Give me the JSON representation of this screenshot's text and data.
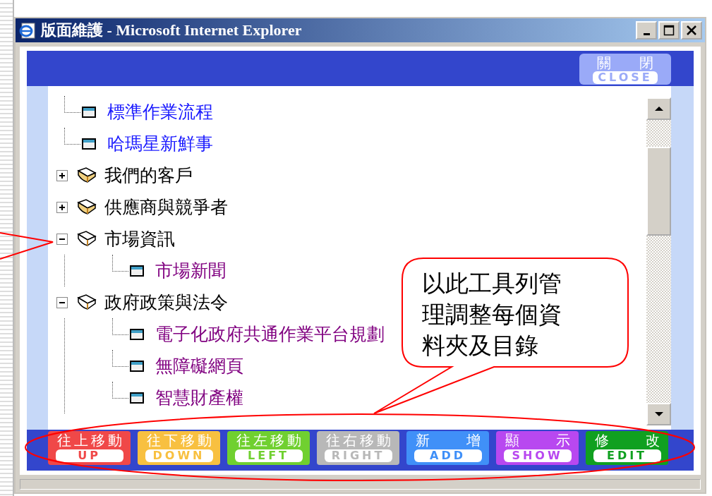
{
  "window": {
    "title": "版面維護 - Microsoft Internet Explorer"
  },
  "close_button": {
    "label": "關閉",
    "sublabel": "CLOSE"
  },
  "tree": [
    {
      "kind": "page",
      "label": "標準作業流程",
      "visited": false
    },
    {
      "kind": "page",
      "label": "哈瑪星新鮮事",
      "visited": false
    },
    {
      "kind": "folder",
      "label": "我們的客戶",
      "expanded": false
    },
    {
      "kind": "folder",
      "label": "供應商與競爭者",
      "expanded": false
    },
    {
      "kind": "folder",
      "label": "市場資訊",
      "expanded": true,
      "children": [
        {
          "kind": "page",
          "label": "市場新聞",
          "visited": true
        }
      ]
    },
    {
      "kind": "folder",
      "label": "政府政策與法令",
      "expanded": true,
      "children": [
        {
          "kind": "page",
          "label": "電子化政府共通作業平台規劃",
          "visited": true
        },
        {
          "kind": "page",
          "label": "無障礙網頁",
          "visited": true
        },
        {
          "kind": "page",
          "label": "智慧財產權",
          "visited": true
        }
      ]
    }
  ],
  "toolbar": [
    {
      "label": "往上移動",
      "sublabel": "UP",
      "color": "#f04848"
    },
    {
      "label": "往下移動",
      "sublabel": "DOWN",
      "color": "#f8c040"
    },
    {
      "label": "往左移動",
      "sublabel": "LEFT",
      "color": "#70d030"
    },
    {
      "label": "往右移動",
      "sublabel": "RIGHT",
      "color": "#b8b8b8"
    },
    {
      "label": "新增",
      "sublabel": "ADD",
      "color": "#4090f8"
    },
    {
      "label": "顯示",
      "sublabel": "SHOW",
      "color": "#b848f0"
    },
    {
      "label": "修改",
      "sublabel": "EDIT",
      "color": "#10a020"
    }
  ],
  "annotation": {
    "callout": "以此工具列管理調整每個資料夾及目錄"
  }
}
